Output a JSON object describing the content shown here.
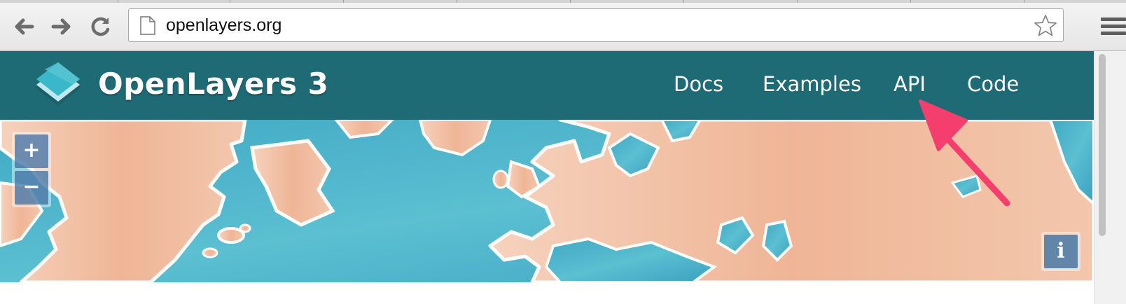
{
  "browser": {
    "url": "openlayers.org",
    "icons": {
      "back": "back-arrow-icon",
      "forward": "forward-arrow-icon",
      "reload": "reload-icon",
      "page": "page-icon",
      "bookmark": "star-icon",
      "menu": "hamburger-menu-icon"
    }
  },
  "header": {
    "title": "OpenLayers 3",
    "nav": [
      "Docs",
      "Examples",
      "API",
      "Code"
    ],
    "background": "#1f6b75",
    "logo_colors": [
      "#3ab8c9",
      "#8fd6df"
    ]
  },
  "map": {
    "zoom_in_label": "+",
    "zoom_out_label": "−",
    "info_label": "i",
    "water_color": "#4ab0c8",
    "land_color": "#efb596"
  },
  "annotation": {
    "arrow_color": "#f43f6e",
    "points_to": "API"
  }
}
